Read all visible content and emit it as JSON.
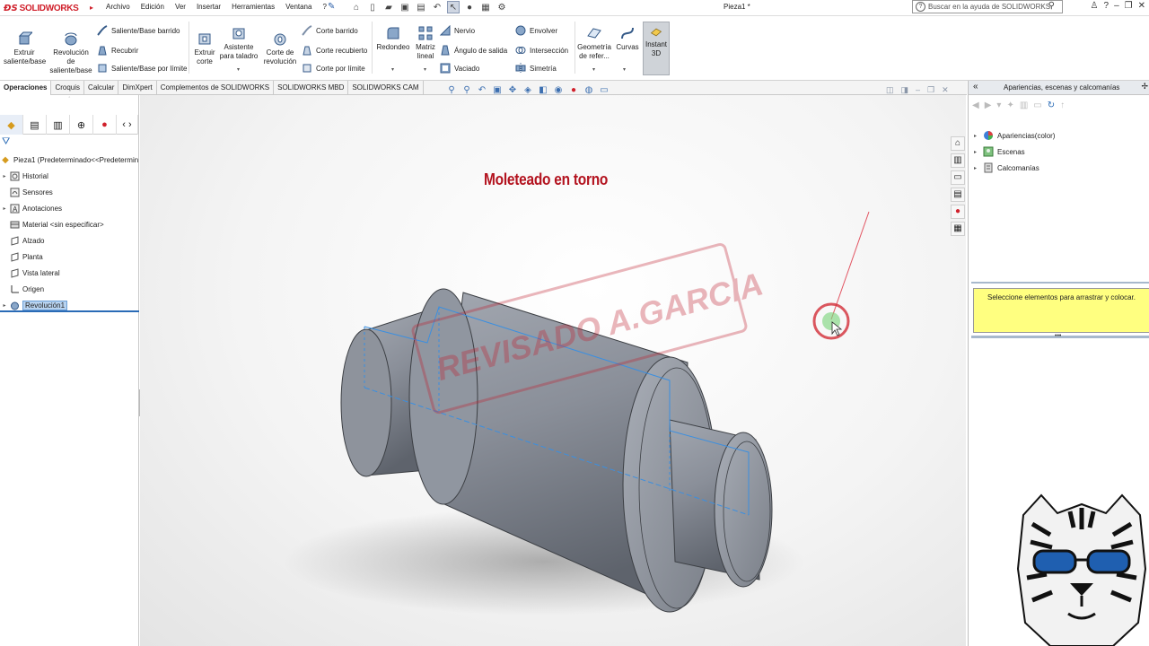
{
  "app": {
    "brand": "SOLIDWORKS",
    "document_title": "Pieza1 *"
  },
  "menu": [
    "Archivo",
    "Edición",
    "Ver",
    "Insertar",
    "Herramientas",
    "Ventana",
    "?"
  ],
  "help_search": {
    "placeholder": "Buscar en la ayuda de SOLIDWORKS"
  },
  "ribbon": {
    "extrude_boss": "Extruir\nsaliente/base",
    "revolve_boss": "Revolución\nde\nsaliente/base",
    "swept_boss": "Saliente/Base barrido",
    "lofted_boss": "Recubrir",
    "boundary_boss": "Saliente/Base por límite",
    "extrude_cut": "Extruir\ncorte",
    "hole_wizard": "Asistente\npara taladro",
    "revolve_cut": "Corte de\nrevolución",
    "swept_cut": "Corte barrido",
    "lofted_cut": "Corte recubierto",
    "boundary_cut": "Corte por límite",
    "fillet": "Redondeo",
    "linear_pattern": "Matriz\nlineal",
    "rib": "Nervio",
    "draft": "Ángulo de salida",
    "shell": "Vaciado",
    "wrap": "Envolver",
    "intersect": "Intersección",
    "mirror": "Simetría",
    "ref_geometry": "Geometría\nde refer...",
    "curves": "Curvas",
    "instant3d": "Instant\n3D"
  },
  "tabs": [
    "Operaciones",
    "Croquis",
    "Calcular",
    "DimXpert",
    "Complementos de SOLIDWORKS",
    "SOLIDWORKS MBD",
    "SOLIDWORKS CAM"
  ],
  "active_tab": "Operaciones",
  "feature_tree": {
    "root": "Pieza1  (Predeterminado<<Predetermin",
    "items": [
      {
        "label": "Historial",
        "expandable": true
      },
      {
        "label": "Sensores",
        "expandable": false
      },
      {
        "label": "Anotaciones",
        "expandable": true
      },
      {
        "label": "Material <sin especificar>",
        "expandable": false
      },
      {
        "label": "Alzado",
        "expandable": false
      },
      {
        "label": "Planta",
        "expandable": false
      },
      {
        "label": "Vista lateral",
        "expandable": false
      },
      {
        "label": "Origen",
        "expandable": false
      },
      {
        "label": "Revolución1",
        "expandable": true,
        "selected": true
      }
    ]
  },
  "graphics": {
    "overlay_title": "Moleteado en torno",
    "watermark": "REVISADO A.GARCIA"
  },
  "task_pane": {
    "title": "Apariencias, escenas y calcomanías",
    "items": [
      "Apariencias(color)",
      "Escenas",
      "Calcomanías"
    ],
    "message": "Seleccione elementos para arrastrar y colocar."
  },
  "colors": {
    "brand_red": "#d0202b",
    "title_red": "#b3131f",
    "selection_blue": "#2a6bb6",
    "part_gray": "#8a8f99",
    "message_yellow": "#ffff80"
  }
}
